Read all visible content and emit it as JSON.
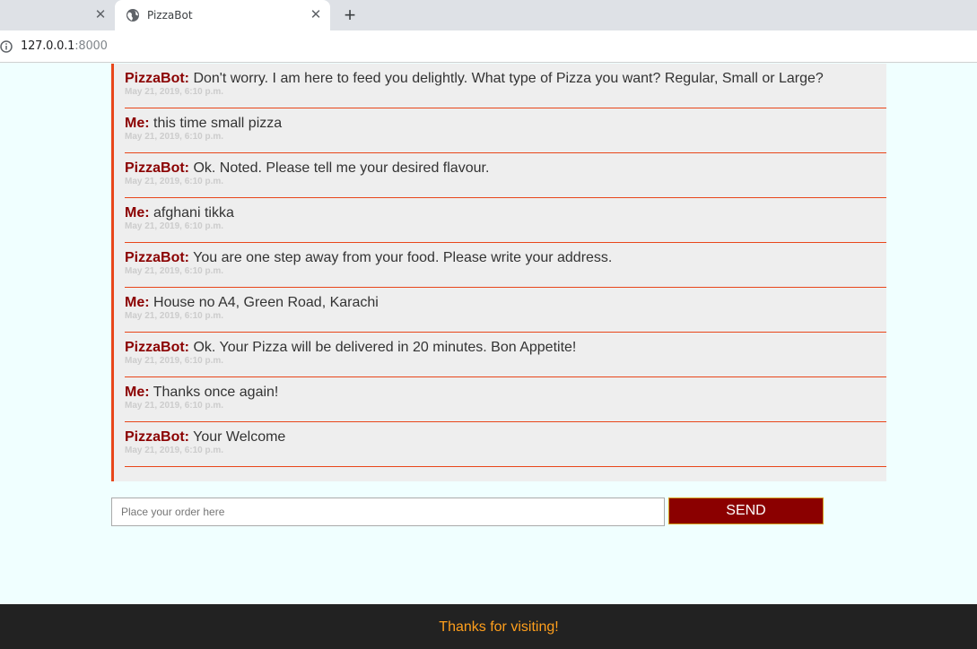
{
  "browser": {
    "tab_title": "PizzaBot",
    "url_host": "127.0.0.1",
    "url_port": ":8000",
    "close_glyph": "✕",
    "newtab_glyph": "+"
  },
  "chat": {
    "messages": [
      {
        "sender": "PizzaBot:",
        "text": " Don't worry. I am here to feed you delightly. What type of Pizza you want? Regular, Small or Large?",
        "time": "May 21, 2019, 6:10 p.m."
      },
      {
        "sender": "Me:",
        "text": " this time small pizza",
        "time": "May 21, 2019, 6:10 p.m."
      },
      {
        "sender": "PizzaBot:",
        "text": " Ok. Noted. Please tell me your desired flavour.",
        "time": "May 21, 2019, 6:10 p.m."
      },
      {
        "sender": "Me:",
        "text": " afghani tikka",
        "time": "May 21, 2019, 6:10 p.m."
      },
      {
        "sender": "PizzaBot:",
        "text": " You are one step away from your food. Please write your address.",
        "time": "May 21, 2019, 6:10 p.m."
      },
      {
        "sender": "Me:",
        "text": " House no A4, Green Road, Karachi",
        "time": "May 21, 2019, 6:10 p.m."
      },
      {
        "sender": "PizzaBot:",
        "text": " Ok. Your Pizza will be delivered in 20 minutes. Bon Appetite!",
        "time": "May 21, 2019, 6:10 p.m."
      },
      {
        "sender": "Me:",
        "text": " Thanks once again!",
        "time": "May 21, 2019, 6:10 p.m."
      },
      {
        "sender": "PizzaBot:",
        "text": " Your Welcome",
        "time": "May 21, 2019, 6:10 p.m."
      }
    ]
  },
  "form": {
    "placeholder": "Place your order here",
    "value": "",
    "send_label": "SEND"
  },
  "footer": {
    "text": "Thanks for visiting!"
  },
  "colors": {
    "sender": "#8b0000",
    "accent_line": "#e8461a",
    "send_button": "#8b0000",
    "footer_text": "#ff9f1c",
    "page_background": "#f0ffff"
  }
}
